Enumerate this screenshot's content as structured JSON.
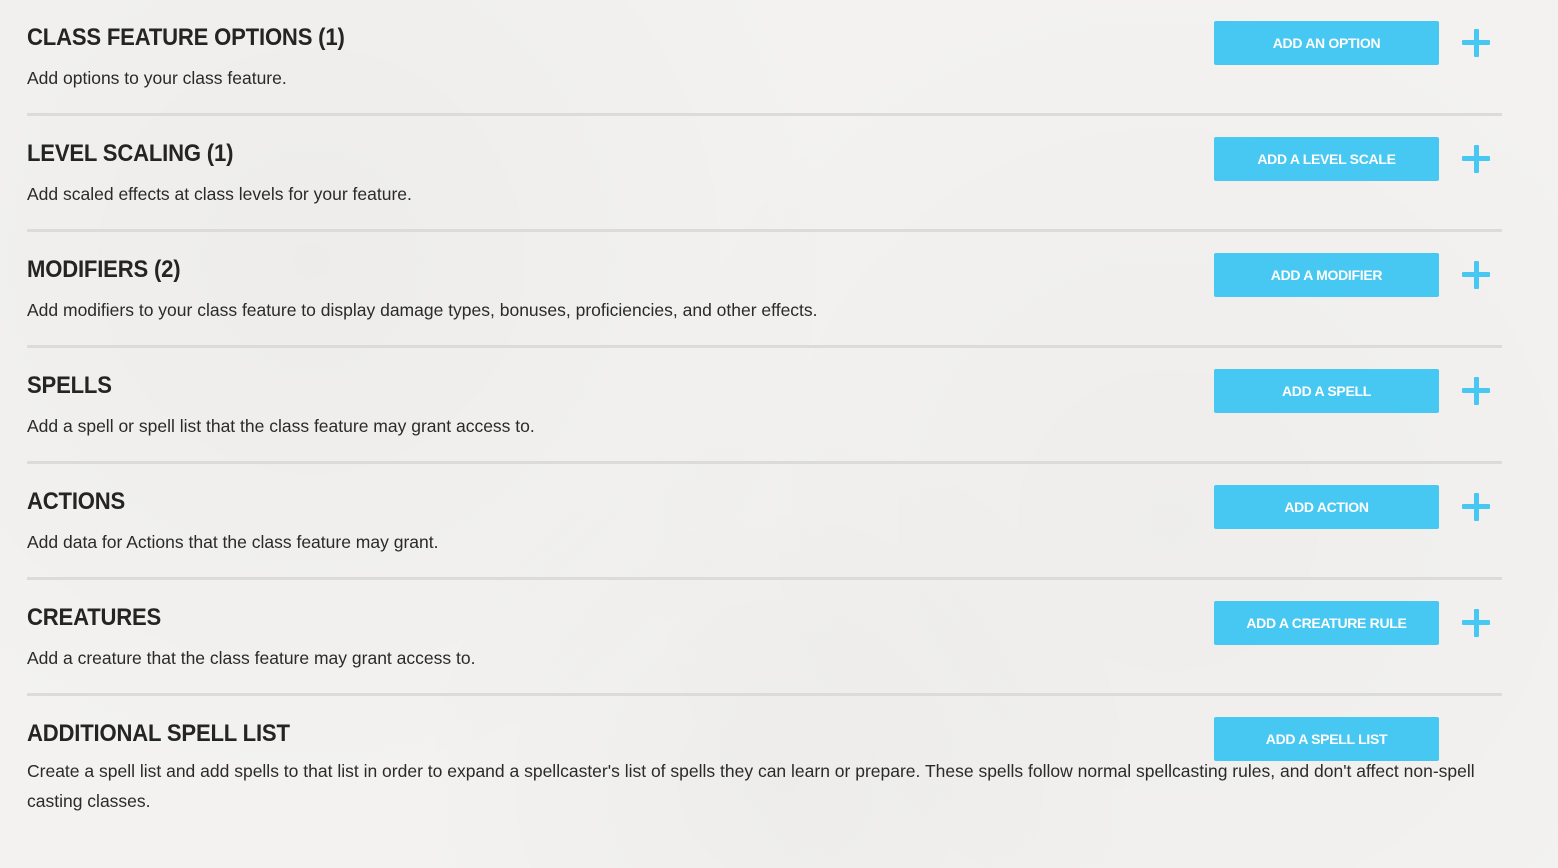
{
  "sections": [
    {
      "title": "CLASS FEATURE OPTIONS (1)",
      "description": "Add options to your class feature.",
      "button_label": "ADD AN OPTION",
      "has_plus": true
    },
    {
      "title": "LEVEL SCALING (1)",
      "description": "Add scaled effects at class levels for your feature.",
      "button_label": "ADD A LEVEL SCALE",
      "has_plus": true
    },
    {
      "title": "MODIFIERS (2)",
      "description": "Add modifiers to your class feature to display damage types, bonuses, proficiencies, and other effects.",
      "button_label": "ADD A MODIFIER",
      "has_plus": true
    },
    {
      "title": "SPELLS",
      "description": "Add a spell or spell list that the class feature may grant access to.",
      "button_label": "ADD A SPELL",
      "has_plus": true
    },
    {
      "title": "ACTIONS",
      "description": "Add data for Actions that the class feature may grant.",
      "button_label": "ADD ACTION",
      "has_plus": true
    },
    {
      "title": "CREATURES",
      "description": "Add a creature that the class feature may grant access to.",
      "button_label": "ADD A CREATURE RULE",
      "has_plus": true
    },
    {
      "title": "ADDITIONAL SPELL LIST",
      "description": "Create a spell list and add spells to that list in order to expand a spellcaster's list of spells they can learn or prepare. These spells follow normal spellcasting rules, and don't affect non-spell casting classes.",
      "button_label": "ADD A SPELL LIST",
      "has_plus": false
    }
  ],
  "colors": {
    "accent": "#47c8f2",
    "divider": "#dcdbd8",
    "text": "#242424",
    "background": "#f3f2f0"
  },
  "icons": {
    "add": "plus-icon"
  }
}
